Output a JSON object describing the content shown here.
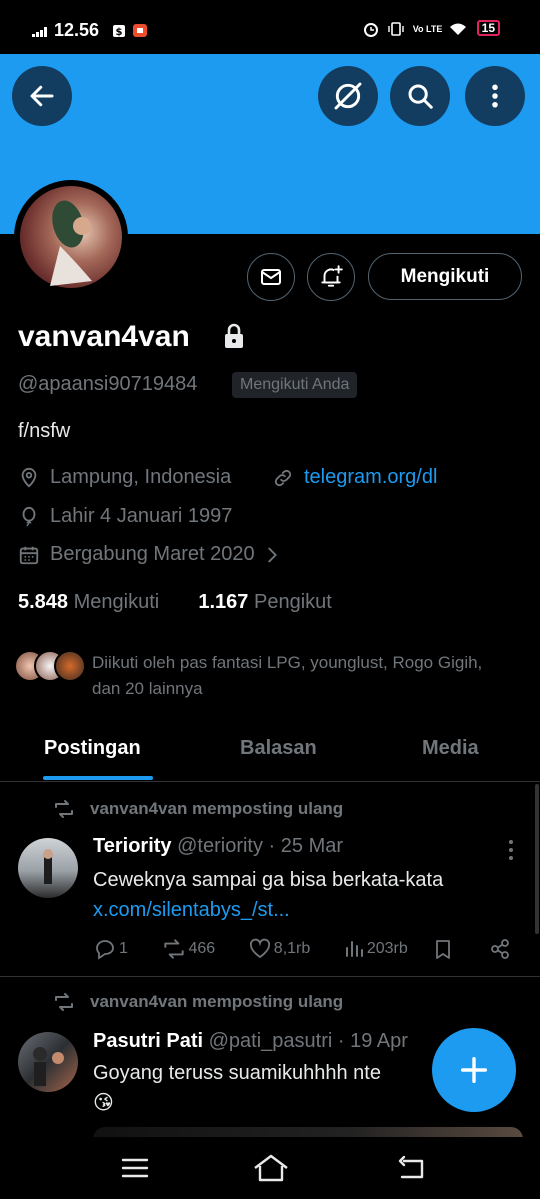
{
  "status_bar": {
    "time": "12.56",
    "battery": "15",
    "network": "Vo LTE"
  },
  "profile": {
    "display_name": "vanvan4van",
    "handle": "@apaansi90719484",
    "follows_you_badge": "Mengikuti Anda",
    "bio": "f/nsfw",
    "location": "Lampung, Indonesia",
    "website": "telegram.org/dl",
    "birthday": "Lahir 4 Januari 1997",
    "joined": "Bergabung Maret 2020",
    "following_count": "5.848",
    "following_label": "Mengikuti",
    "followers_count": "1.167",
    "followers_label": "Pengikut",
    "followed_by": "Diikuti oleh pas fantasi LPG, younglust, Rogo Gigih, dan 20 lainnya"
  },
  "buttons": {
    "follow": "Mengikuti"
  },
  "tabs": [
    {
      "label": "Postingan"
    },
    {
      "label": "Balasan"
    },
    {
      "label": "Media"
    }
  ],
  "posts": [
    {
      "repost_label": "vanvan4van memposting ulang",
      "author_name": "Teriority",
      "author_handle": "@teriority",
      "date": "· 25 Mar",
      "text": "Ceweknya sampai ga bisa berkata-kata",
      "link": "x.com/silentabys_/st...",
      "replies": "1",
      "reposts": "466",
      "likes": "8,1rb",
      "views": "203rb"
    },
    {
      "repost_label": "vanvan4van memposting ulang",
      "author_name": "Pasutri Pati",
      "author_handle": "@pati_pasutri",
      "date": "· 19 Apr",
      "text": "Goyang teruss suamikuhhhh nte",
      "emoji": "😘"
    }
  ],
  "colors": {
    "accent": "#1d9bf0",
    "background": "#000000",
    "muted": "#71767b"
  },
  "icons": [
    "back-arrow-icon",
    "explore-off-icon",
    "search-icon",
    "more-vertical-icon",
    "mail-icon",
    "bell-plus-icon",
    "lock-icon",
    "location-icon",
    "link-icon",
    "balloon-icon",
    "calendar-icon",
    "chevron-right-icon",
    "repost-icon",
    "reply-icon",
    "like-icon",
    "views-icon",
    "bookmark-icon",
    "share-icon",
    "plus-icon",
    "menu-icon",
    "home-icon",
    "back-nav-icon"
  ]
}
